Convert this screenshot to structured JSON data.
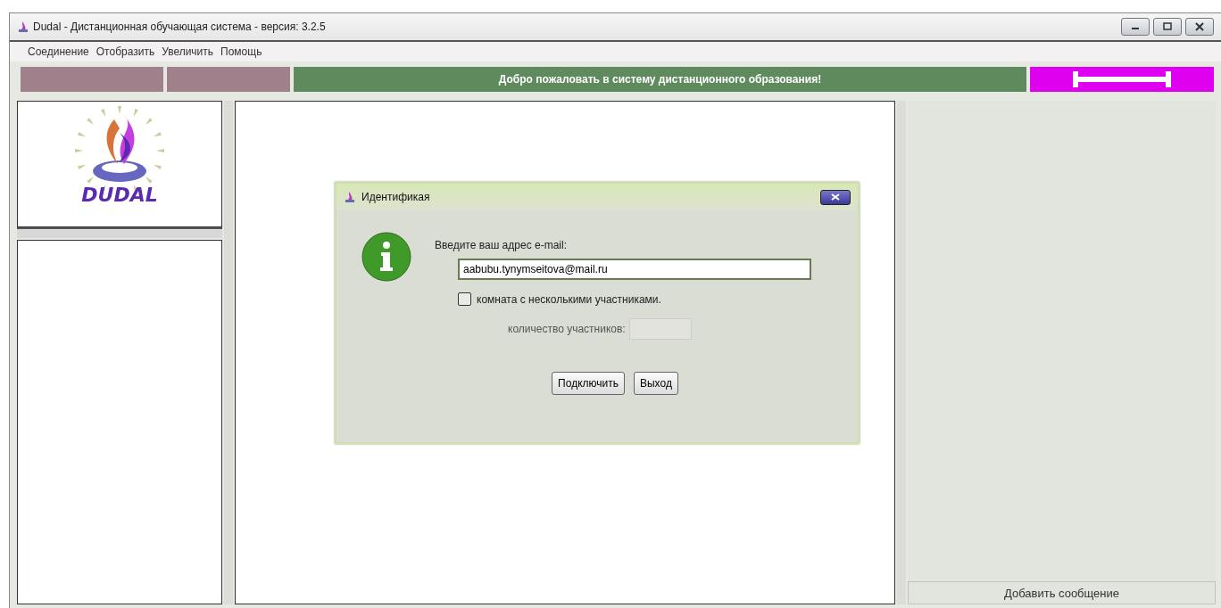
{
  "window": {
    "title": "Dudal - Дистанционная обучающая система - версия: 3.2.5"
  },
  "menu": [
    "Соединение",
    "Отобразить",
    "Увеличить",
    "Помощь"
  ],
  "status_bar": {
    "welcome": "Добро пожаловать в систему дистанционного образования!"
  },
  "logo": {
    "text": "DUDAL"
  },
  "chat_panel": {
    "add_button": "Добавить сообщение"
  },
  "dialog": {
    "title": "Идентификая",
    "prompt": "Введите ваш адрес e-mail:",
    "email": "aabubu.tynymseitova@mail.ru",
    "multi_room": {
      "label": "комната с несколькими участниками.",
      "checked": false
    },
    "participants": {
      "label": "количество участников:",
      "disabled": true
    },
    "buttons": [
      "Подключить",
      "Выход"
    ]
  }
}
